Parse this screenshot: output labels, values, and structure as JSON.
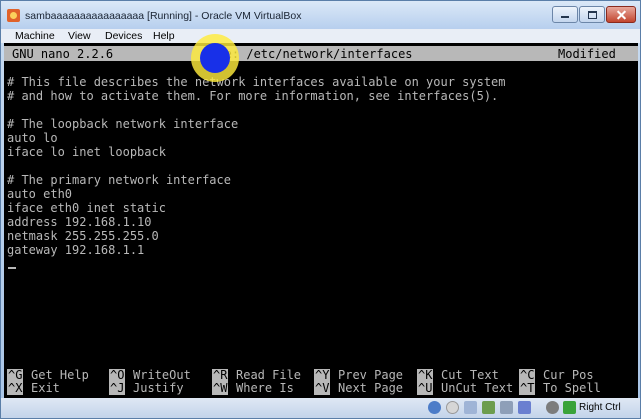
{
  "window": {
    "title": "sambaaaaaaaaaaaaaaaa [Running] - Oracle VM VirtualBox"
  },
  "menubar": [
    "Machine",
    "View",
    "Devices",
    "Help"
  ],
  "nano": {
    "version": "GNU nano 2.2.6",
    "file_label": "File: /etc/network/interfaces",
    "status": "Modified"
  },
  "file_lines": [
    "# This file describes the network interfaces available on your system",
    "# and how to activate them. For more information, see interfaces(5).",
    "",
    "# The loopback network interface",
    "auto lo",
    "iface lo inet loopback",
    "",
    "# The primary network interface",
    "auto eth0",
    "iface eth0 inet static",
    "address 192.168.1.10",
    "netmask 255.255.255.0",
    "gateway 192.168.1.1"
  ],
  "shortcuts": [
    [
      {
        "key": "^G",
        "label": "Get Help"
      },
      {
        "key": "^O",
        "label": "WriteOut"
      },
      {
        "key": "^R",
        "label": "Read File"
      },
      {
        "key": "^Y",
        "label": "Prev Page"
      },
      {
        "key": "^K",
        "label": "Cut Text"
      },
      {
        "key": "^C",
        "label": "Cur Pos"
      }
    ],
    [
      {
        "key": "^X",
        "label": "Exit"
      },
      {
        "key": "^J",
        "label": "Justify"
      },
      {
        "key": "^W",
        "label": "Where Is"
      },
      {
        "key": "^V",
        "label": "Next Page"
      },
      {
        "key": "^U",
        "label": "UnCut Text"
      },
      {
        "key": "^T",
        "label": "To Spell"
      }
    ]
  ],
  "statusbar": {
    "host_key": "Right Ctrl",
    "icons": [
      "hard-disk-icon",
      "optical-drive-icon",
      "floppy-icon",
      "network-icon",
      "usb-icon",
      "shared-folder-icon",
      "mouse-capture-icon",
      "keyboard-capture-icon"
    ]
  }
}
